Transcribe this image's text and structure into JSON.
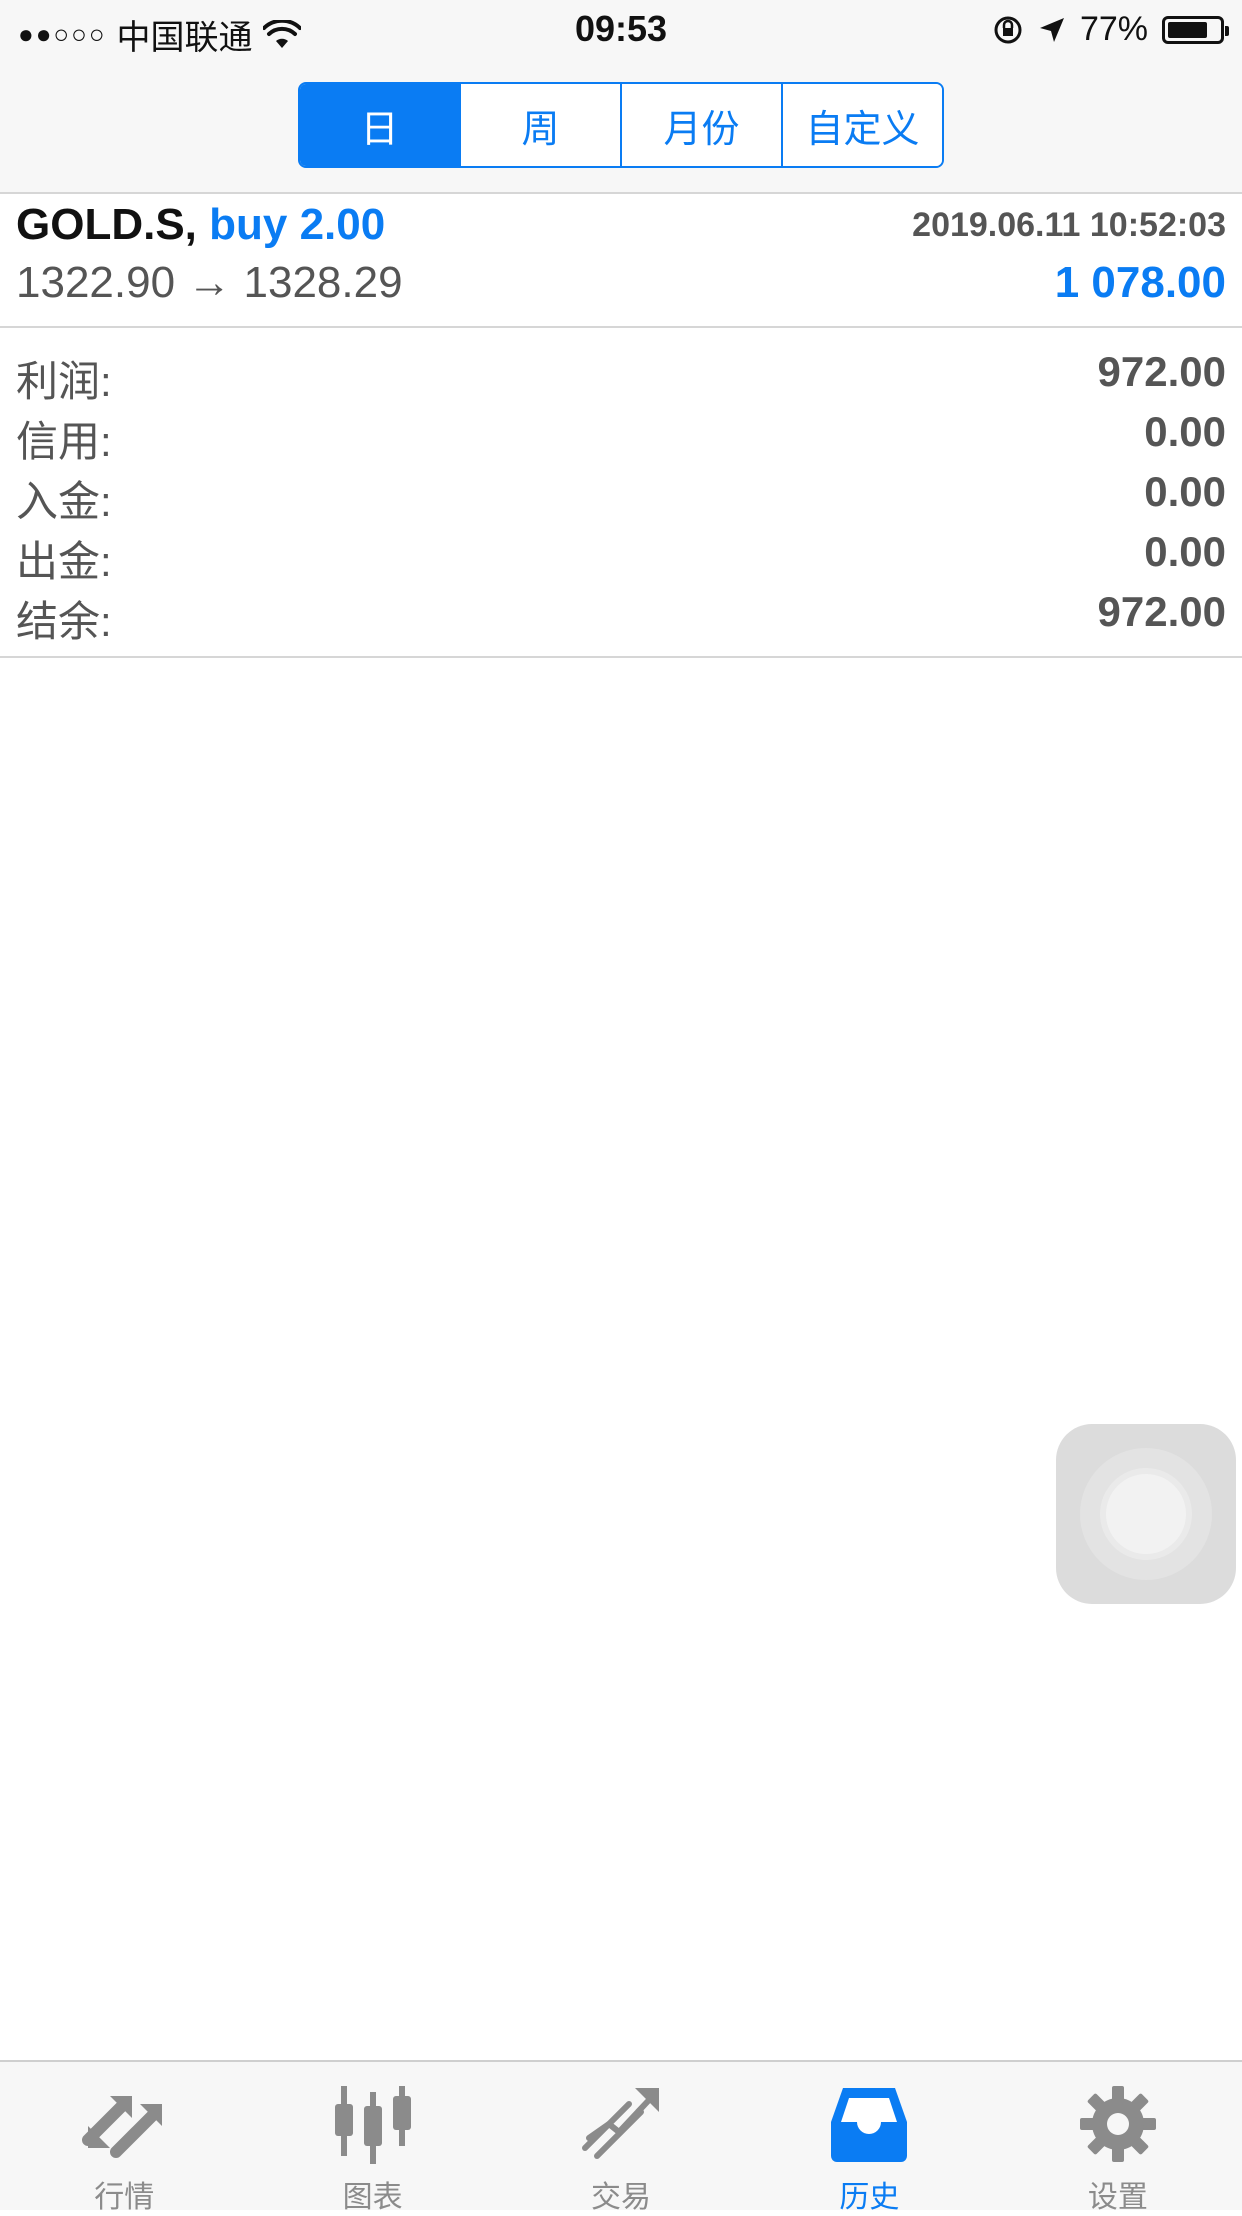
{
  "status_bar": {
    "signal": "●●○○○",
    "carrier": "中国联通",
    "time": "09:53",
    "battery": "77%",
    "battery_level": 0.77
  },
  "period_tabs": [
    {
      "label": "日",
      "active": true
    },
    {
      "label": "周",
      "active": false
    },
    {
      "label": "月份",
      "active": false
    },
    {
      "label": "自定义",
      "active": false
    }
  ],
  "trade": {
    "symbol": "GOLD.S,",
    "action": "buy 2.00",
    "datetime": "2019.06.11 10:52:03",
    "prices": "1322.90 → 1328.29",
    "profit": "1 078.00"
  },
  "summary": [
    {
      "label": "利润:",
      "value": "972.00"
    },
    {
      "label": "信用:",
      "value": "0.00"
    },
    {
      "label": "入金:",
      "value": "0.00"
    },
    {
      "label": "出金:",
      "value": "0.00"
    },
    {
      "label": "结余:",
      "value": "972.00"
    }
  ],
  "tabbar": [
    {
      "label": "行情",
      "icon": "quotes-icon",
      "active": false
    },
    {
      "label": "图表",
      "icon": "chart-icon",
      "active": false
    },
    {
      "label": "交易",
      "icon": "trade-icon",
      "active": false
    },
    {
      "label": "历史",
      "icon": "history-icon",
      "active": true
    },
    {
      "label": "设置",
      "icon": "settings-icon",
      "active": false
    }
  ],
  "colors": {
    "accent": "#0a7cf3",
    "text_gray": "#555555",
    "tab_inactive": "#8b8b8b"
  }
}
